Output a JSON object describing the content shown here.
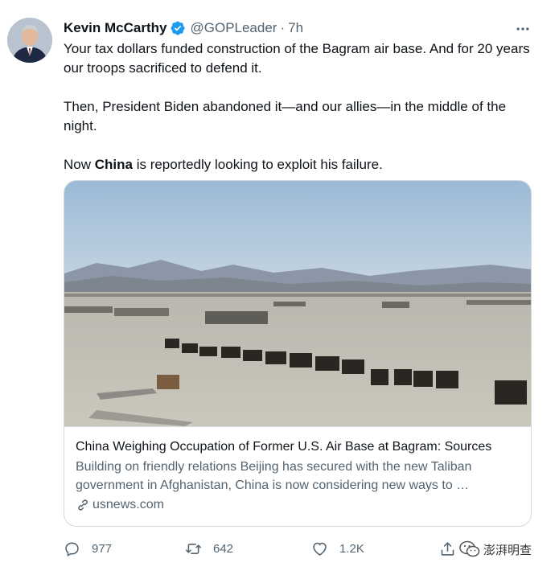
{
  "author": {
    "name": "Kevin McCarthy",
    "handle": "@GOPLeader",
    "separator": "·",
    "time": "7h",
    "verified_color": "#1d9bf0"
  },
  "tweet": {
    "paragraph1": "Your tax dollars funded construction of the Bagram air base. And for 20 years our troops sacrificed to defend it.",
    "paragraph2": "Then, President Biden abandoned it—and our allies—in the middle of the night.",
    "paragraph3_prefix": "Now ",
    "paragraph3_bold": "China",
    "paragraph3_suffix": " is reportedly looking to exploit his failure."
  },
  "card": {
    "title": "China Weighing Occupation of Former U.S. Air Base at Bagram: Sources",
    "description": "Building on friendly relations Beijing has secured with the new Taliban government in Afghanistan, China is now considering new ways to …",
    "domain": "usnews.com"
  },
  "actions": {
    "replies": "977",
    "retweets": "642",
    "likes": "1.2K"
  },
  "watermark": {
    "text": "澎湃明查"
  },
  "icons": {
    "more": "more-icon",
    "reply": "reply-icon",
    "retweet": "retweet-icon",
    "like": "heart-icon",
    "share": "share-icon",
    "link": "link-icon"
  }
}
